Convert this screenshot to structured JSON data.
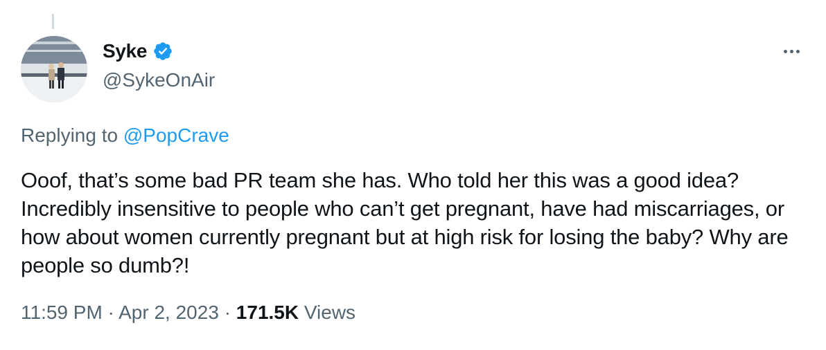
{
  "author": {
    "display_name": "Syke",
    "handle": "@SykeOnAir",
    "verified_icon": "verified-badge-icon",
    "accent_color": "#1d9bf0"
  },
  "reply": {
    "prefix": "Replying to",
    "mention": "@PopCrave"
  },
  "tweet": {
    "text": "Ooof, that’s some bad PR team she has. Who told her this was a good idea? Incredibly insensitive to people who can’t get pregnant, have had miscarriages, or how about women currently pregnant but at high risk for losing the baby? Why are people so dumb?!"
  },
  "meta": {
    "time": "11:59 PM",
    "separator": "·",
    "date": "Apr 2, 2023",
    "views_count": "171.5K",
    "views_label": "Views"
  }
}
